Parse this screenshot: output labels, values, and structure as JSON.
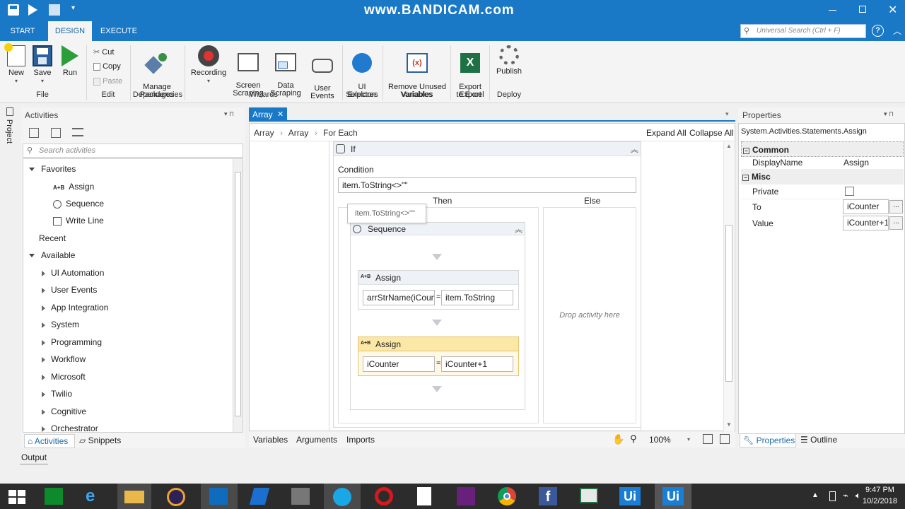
{
  "watermark": "www.BANDICAM.com",
  "ribbon_tabs": [
    "START",
    "DESIGN",
    "EXECUTE"
  ],
  "search": {
    "placeholder": "Universal Search (Ctrl + F)"
  },
  "ribbon": {
    "new": "New",
    "save": "Save",
    "run": "Run",
    "cut": "Cut",
    "copy": "Copy",
    "paste": "Paste",
    "manage_packages": "Manage\nPackages",
    "recording": "Recording",
    "screen_scraping": "Screen\nScraping",
    "data_scraping": "Data\nScraping",
    "user_events": "User\nEvents",
    "ui_explorer": "UI\nExplorer",
    "remove_unused": "Remove Unused\nVariables",
    "export_excel": "Export\nto Excel",
    "publish": "Publish",
    "groups": {
      "file": "File",
      "edit": "Edit",
      "dependencies": "Dependencies",
      "wizards": "Wizards",
      "selectors": "Selectors",
      "variables": "Variables",
      "export": "Export",
      "deploy": "Deploy"
    }
  },
  "project_tab": "Project",
  "activities": {
    "title": "Activities",
    "search_placeholder": "Search activities",
    "favorites": "Favorites",
    "fav_items": [
      "Assign",
      "Sequence",
      "Write Line"
    ],
    "recent": "Recent",
    "available": "Available",
    "available_items": [
      "UI Automation",
      "User Events",
      "App Integration",
      "System",
      "Programming",
      "Workflow",
      "Microsoft",
      "Twilio",
      "Cognitive",
      "Orchestrator"
    ],
    "bottom_tabs": [
      "Activities",
      "Snippets"
    ]
  },
  "designer": {
    "tab": "Array",
    "breadcrumb": [
      "Array",
      "Array",
      "For Each"
    ],
    "expand_all": "Expand All",
    "collapse_all": "Collapse All",
    "if_title": "If",
    "condition_label": "Condition",
    "condition_value": "item.ToString<>\"\"",
    "tooltip": "item.ToString<>\"\"",
    "then": "Then",
    "else": "Else",
    "sequence_title": "Sequence",
    "assign1": {
      "title": "Assign",
      "to": "arrStrName(iCount",
      "value": "item.ToString"
    },
    "assign2": {
      "title": "Assign",
      "to": "iCounter",
      "value": "iCounter+1"
    },
    "drop_here": "Drop activity here",
    "bottom_tabs": [
      "Variables",
      "Arguments",
      "Imports"
    ],
    "zoom": "100%"
  },
  "properties": {
    "title": "Properties",
    "type": "System.Activities.Statements.Assign",
    "common": "Common",
    "display_name_label": "DisplayName",
    "display_name_value": "Assign",
    "misc": "Misc",
    "private_label": "Private",
    "to_label": "To",
    "to_value": "iCounter",
    "value_label": "Value",
    "value_value": "iCounter+1",
    "bottom_tabs": [
      "Properties",
      "Outline"
    ]
  },
  "output_label": "Output",
  "clock": {
    "time": "9:47 PM",
    "date": "10/2/2018"
  },
  "colors": {
    "accent": "#1a79c7",
    "assign_selected": "#fbe7a6"
  }
}
